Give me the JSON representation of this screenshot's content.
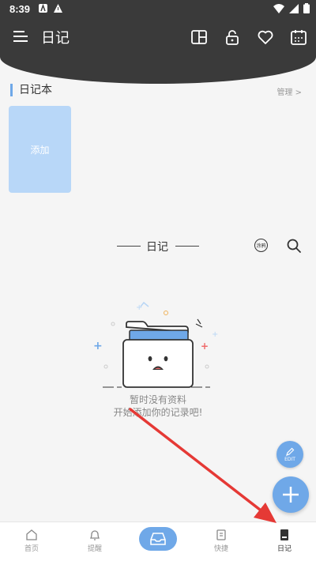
{
  "status_bar": {
    "time": "8:39"
  },
  "header": {
    "title": "日记"
  },
  "notebook": {
    "title": "日记本",
    "manage": "管理 >",
    "add_label": "添加"
  },
  "diary": {
    "title": "日记",
    "sticker_label": "涂鸦"
  },
  "empty": {
    "line1": "暂时没有资料",
    "line2": "开始添加你的记录吧!"
  },
  "fab": {
    "edit_label": "EDIT"
  },
  "bottom_nav": {
    "items": [
      {
        "label": "首页"
      },
      {
        "label": "提醒"
      },
      {
        "label": "快捷"
      },
      {
        "label": "日记"
      }
    ]
  },
  "colors": {
    "accent": "#6fa8e8",
    "header": "#3a3a3a",
    "annotation": "#e53935"
  }
}
